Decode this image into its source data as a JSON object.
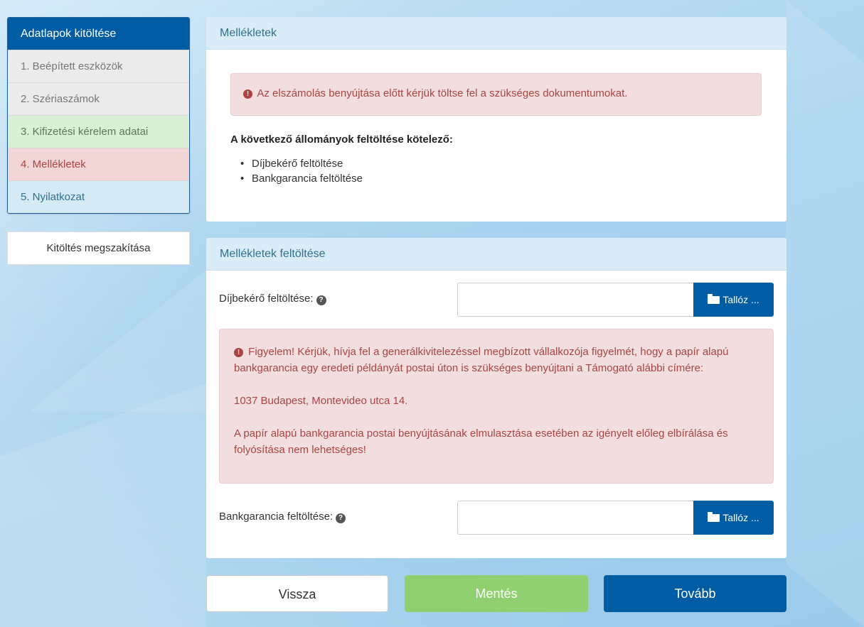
{
  "sidebar": {
    "title": "Adatlapok kitöltése",
    "steps": [
      {
        "label": "1. Beépített eszközök"
      },
      {
        "label": "2. Szériaszámok"
      },
      {
        "label": "3. Kifizetési kérelem adatai"
      },
      {
        "label": "4. Mellékletek"
      },
      {
        "label": "5. Nyilatkozat"
      }
    ],
    "cancel_label": "Kitöltés megszakítása"
  },
  "attachments_panel": {
    "title": "Mellékletek",
    "alert": "Az elszámolás benyújtása előtt kérjük töltse fel a szükséges dokumentumokat.",
    "required_title": "A következő állományok feltöltése kötelező:",
    "required_items": [
      "Díjbekérő feltöltése",
      "Bankgarancia feltöltése"
    ]
  },
  "upload_panel": {
    "title": "Mellékletek feltöltése",
    "fee_label": "Díjbekérő feltöltése:",
    "guarantee_label": "Bankgarancia feltöltése:",
    "browse_label": "Tallóz ...",
    "warning": {
      "line1": "Figyelem! Kérjük, hívja fel a generálkivitelezéssel megbízott vállalkozója figyelmét, hogy a papír alapú bankgarancia egy eredeti példányát postai úton is szükséges benyújtani a Támogató alábbi címére:",
      "address": "1037 Budapest, Montevideo utca 14.",
      "line3": "A papír alapú bankgarancia postai benyújtásának elmulasztása esetében az igényelt előleg elbírálása és folyósítása nem lehetséges!"
    }
  },
  "footer": {
    "back_label": "Vissza",
    "save_label": "Mentés",
    "next_label": "Tovább"
  },
  "icons": {
    "alert": "exclamation-circle-icon",
    "help": "question-circle-icon",
    "folder": "folder-open-icon"
  },
  "colors": {
    "primary": "#005ca3",
    "success": "#90d070",
    "danger_bg": "#f2dede",
    "danger_text": "#a94442",
    "info_bg": "#d9ecf7"
  }
}
